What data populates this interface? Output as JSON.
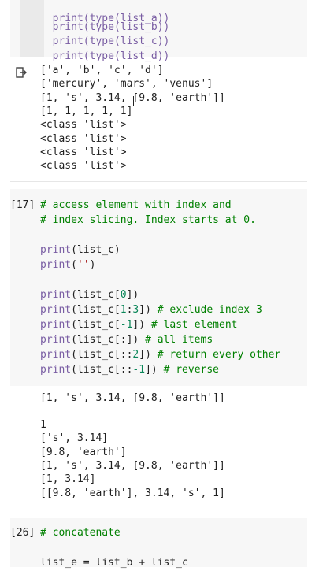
{
  "cell_top": {
    "lines": [
      "print(type(list_a))",
      "print(type(list_b))",
      "print(type(list_c))",
      "print(type(list_d))"
    ]
  },
  "output_top": {
    "lines": [
      "['a', 'b', 'c', 'd']",
      "['mercury', 'mars', 'venus']",
      "[1, 's', 3.14, [9.8, 'earth']]",
      "[1, 1, 1, 1, 1]",
      "<class 'list'>",
      "<class 'list'>",
      "<class 'list'>",
      "<class 'list'>"
    ]
  },
  "cell_17": {
    "prompt": "[17]",
    "lines": [
      "# access element with index and",
      "# index slicing. Index starts at 0.",
      "",
      "print(list_c)",
      "print('')",
      "",
      "print(list_c[0])",
      "print(list_c[1:3]) # exclude index 3",
      "print(list_c[-1]) # last element",
      "print(list_c[:]) # all items",
      "print(list_c[::2]) # return every other",
      "print(list_c[::-1]) # reverse"
    ]
  },
  "output_17": {
    "lines": [
      "[1, 's', 3.14, [9.8, 'earth']]",
      "",
      "1",
      "['s', 3.14]",
      "[9.8, 'earth']",
      "[1, 's', 3.14, [9.8, 'earth']]",
      "[1, 3.14]",
      "[[9.8, 'earth'], 3.14, 's', 1]"
    ]
  },
  "cell_26": {
    "prompt": "[26]",
    "lines": [
      "# concatenate",
      "",
      "list_e = list_b + list_c"
    ]
  },
  "colors": {
    "builtin": "#795da3",
    "comment": "#008000",
    "number": "#098658",
    "string": "#a31515",
    "cell_bg": "#f7f7f7"
  }
}
